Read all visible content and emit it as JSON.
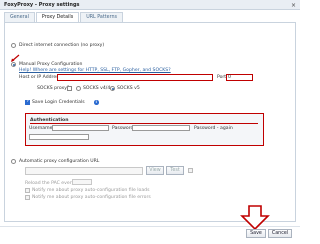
{
  "window": {
    "title": "FoxyProxy - Proxy settings",
    "close_glyph": "×"
  },
  "tabs": [
    {
      "label": "General"
    },
    {
      "label": "Proxy Details"
    },
    {
      "label": "URL Patterns"
    }
  ],
  "direct": {
    "label": "Direct internet connection (no proxy)"
  },
  "manual": {
    "label": "Manual Proxy Configuration",
    "help_link": "Help! Where are settings for HTTP, SSL, FTP, Gopher, and SOCKS?",
    "host_label": "Host or IP Address",
    "host_value": "",
    "port_label": "Port",
    "port_value": "0",
    "socks_label": "SOCKS proxy?",
    "socks_v4": "SOCKS v4/4a",
    "socks_v5": "SOCKS v5",
    "save_credentials": "Save Login Credentials"
  },
  "auth": {
    "legend": "Authentication",
    "username_label": "Username",
    "password_label": "Password",
    "password_again_label": "Password - again",
    "username_value": "",
    "password_value": "",
    "password_again_value": ""
  },
  "auto": {
    "label": "Automatic proxy configuration URL",
    "url_value": "",
    "view_button": "View",
    "test_button": "Test",
    "reload_label": "Reload the PAC every",
    "notify_load": "Notify me about proxy auto-configuration file loads",
    "notify_errors": "Notify me about proxy auto-configuration file errors"
  },
  "footer": {
    "save_button": "Save",
    "cancel_button": "Cancel"
  },
  "colors": {
    "highlight": "#c00000",
    "accent": "#2a6ad0"
  }
}
